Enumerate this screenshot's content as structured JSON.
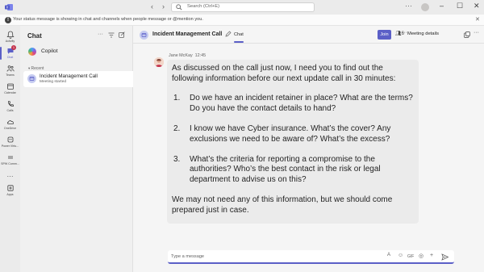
{
  "titlebar": {
    "search_placeholder": "Search (Ctrl+E)",
    "back": "‹",
    "forward": "›",
    "more": "···",
    "minimize": "–",
    "maximize": "☐",
    "close": "✕"
  },
  "banner": {
    "text": "Your status message is showing in chat and channels when people message or @mention you.",
    "close": "✕"
  },
  "rail": {
    "items": [
      {
        "label": "Activity",
        "icon": "bell-icon"
      },
      {
        "label": "Chat",
        "icon": "chat-icon"
      },
      {
        "label": "Teams",
        "icon": "teams-icon"
      },
      {
        "label": "Calendar",
        "icon": "calendar-icon"
      },
      {
        "label": "Calls",
        "icon": "phone-icon"
      },
      {
        "label": "OneDrive",
        "icon": "cloud-icon"
      },
      {
        "label": "Power Virtu...",
        "icon": "power-virtual-agents-icon"
      },
      {
        "label": "SPW Comm...",
        "icon": "app-icon"
      },
      {
        "label": "···",
        "icon": "more-icon"
      },
      {
        "label": "Apps",
        "icon": "apps-icon"
      }
    ],
    "chat_badge": "1"
  },
  "chatlist": {
    "title": "Chat",
    "copilot_label": "Copilot",
    "recent_label": "Recent",
    "chats": [
      {
        "name": "Incident Management Call",
        "subtitle": "Meeting started"
      }
    ]
  },
  "header": {
    "title": "Incident Management Call",
    "tab_label": "Chat",
    "join_label": "Join",
    "people_count": "6",
    "meeting_details_label": "Meeting details"
  },
  "message": {
    "sender": "Jane McKay",
    "time": "12:45",
    "intro": "As discussed on the call just now, I need you to find out the following information before our next update call in 30 minutes:",
    "items": [
      {
        "num": "1.",
        "text": "Do we have an incident retainer in place? What are the terms? Do you have the contact details to hand?"
      },
      {
        "num": "2.",
        "text": "I know we have Cyber insurance. What’s the cover? Any exclusions we need to be aware of? What’s the excess?"
      },
      {
        "num": "3.",
        "text": "What’s the criteria for reporting a compromise to the authorities? Who’s the best contact in the risk or legal department to advise us on this?"
      }
    ],
    "closing": "We may not need any of this information, but we should come prepared just in case."
  },
  "compose": {
    "placeholder": "Type a message"
  },
  "colors": {
    "accent": "#5b5fc7",
    "badge": "#c4314b"
  }
}
